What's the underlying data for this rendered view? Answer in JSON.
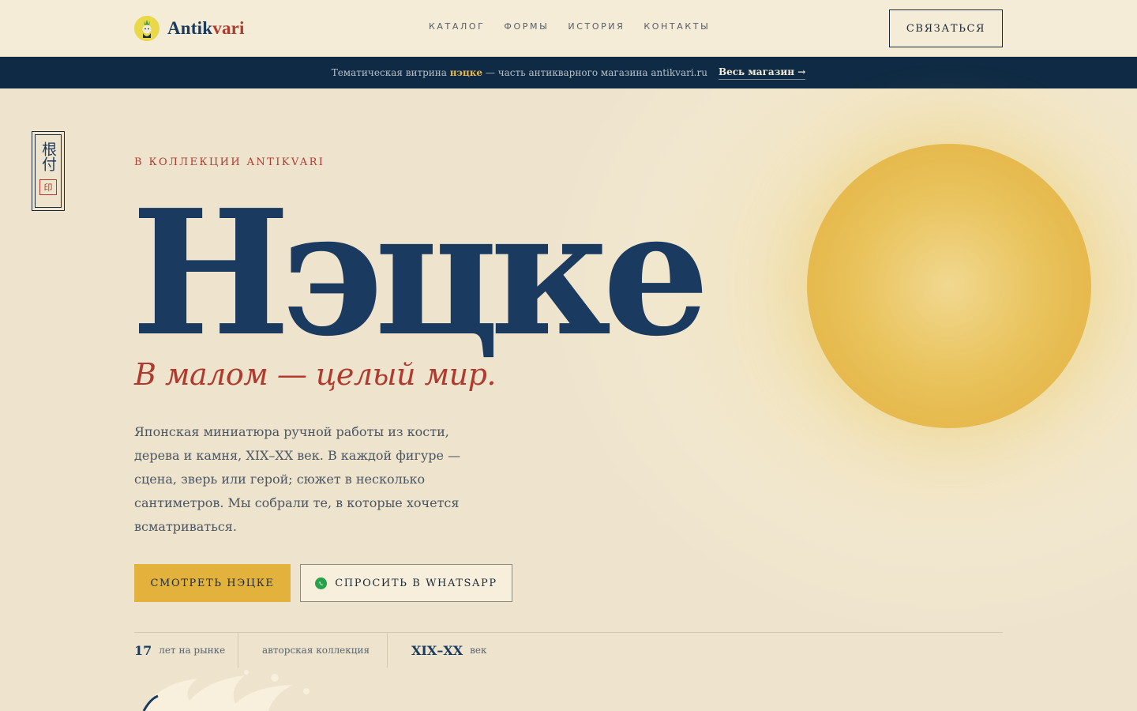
{
  "header": {
    "logo": {
      "text_main": "Antik",
      "text_accent": "vari"
    },
    "nav": [
      "КАТАЛОГ",
      "ФОРМЫ",
      "ИСТОРИЯ",
      "КОНТАКТЫ"
    ],
    "contact_label": "СВЯЗАТЬСЯ"
  },
  "banner": {
    "text_before": "Тематическая витрина",
    "highlight": "нэцке",
    "text_after": "— часть антикварного магазина antikvari.ru",
    "link_label": "Весь магазин →"
  },
  "hero": {
    "seal": {
      "kanji": "根付",
      "stamp": "印"
    },
    "eyebrow": "В КОЛЛЕКЦИИ ANTIKVARI",
    "title": "Нэцке",
    "subtitle": "В малом — целый мир.",
    "description": "Японская миниатюра ручной работы из кости, дерева и камня, XIX–XX век. В каждой фигуре — сцена, зверь или герой; сюжет в несколько сантиметров. Мы собрали те, в которые хочется всматриваться.",
    "primary_button": "СМОТРЕТЬ НЭЦКЕ",
    "secondary_button": "СПРОСИТЬ В WHATSAPP",
    "stats": [
      {
        "value": "17",
        "label": "лет на рынке"
      },
      {
        "value": "",
        "label": "авторская коллекция"
      },
      {
        "value": "XIX–XX",
        "label": "век"
      }
    ]
  },
  "colors": {
    "navy": "#1a3a5f",
    "red": "#b03a2e",
    "gold": "#e3b23c",
    "banner_bg": "#0f2a44",
    "page_bg": "#f2e8cf"
  },
  "icons": [
    "logo-mascot-icon",
    "whatsapp-icon",
    "sun-decoration",
    "wave-decoration"
  ]
}
